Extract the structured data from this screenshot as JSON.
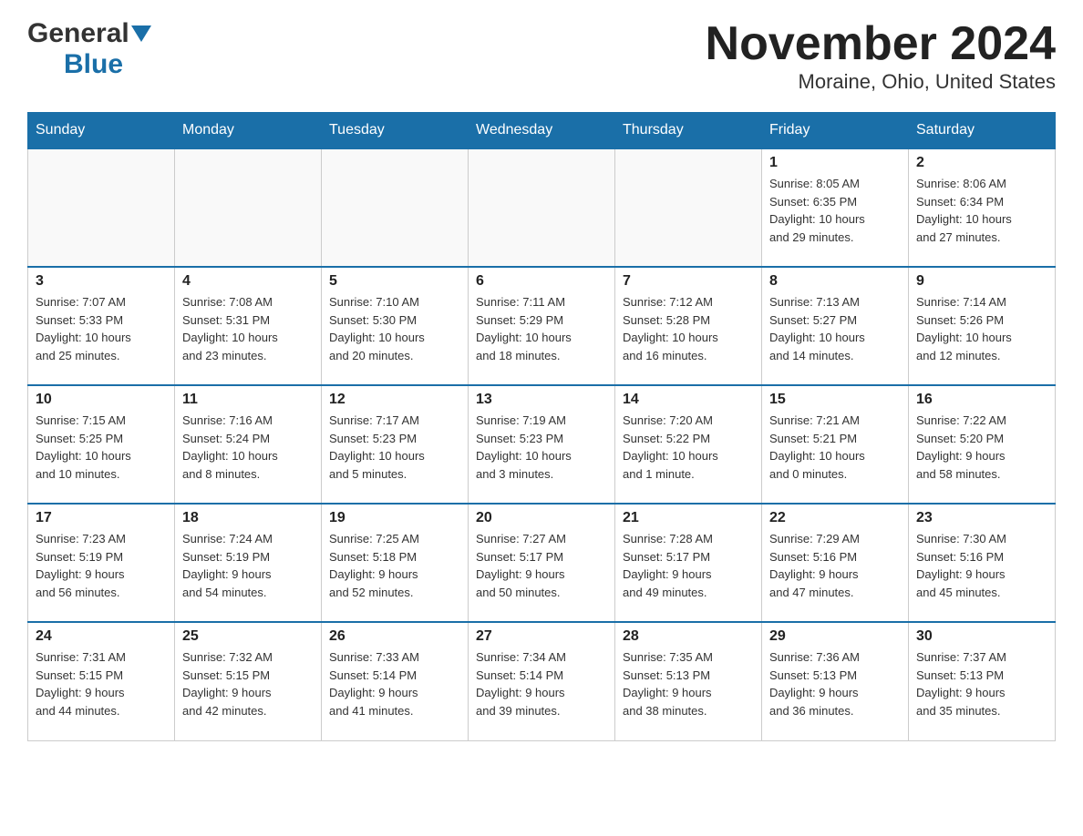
{
  "header": {
    "logo_general": "General",
    "logo_blue": "Blue",
    "month_title": "November 2024",
    "location": "Moraine, Ohio, United States"
  },
  "days_of_week": [
    "Sunday",
    "Monday",
    "Tuesday",
    "Wednesday",
    "Thursday",
    "Friday",
    "Saturday"
  ],
  "weeks": [
    {
      "days": [
        {
          "number": "",
          "info": ""
        },
        {
          "number": "",
          "info": ""
        },
        {
          "number": "",
          "info": ""
        },
        {
          "number": "",
          "info": ""
        },
        {
          "number": "",
          "info": ""
        },
        {
          "number": "1",
          "info": "Sunrise: 8:05 AM\nSunset: 6:35 PM\nDaylight: 10 hours\nand 29 minutes."
        },
        {
          "number": "2",
          "info": "Sunrise: 8:06 AM\nSunset: 6:34 PM\nDaylight: 10 hours\nand 27 minutes."
        }
      ]
    },
    {
      "days": [
        {
          "number": "3",
          "info": "Sunrise: 7:07 AM\nSunset: 5:33 PM\nDaylight: 10 hours\nand 25 minutes."
        },
        {
          "number": "4",
          "info": "Sunrise: 7:08 AM\nSunset: 5:31 PM\nDaylight: 10 hours\nand 23 minutes."
        },
        {
          "number": "5",
          "info": "Sunrise: 7:10 AM\nSunset: 5:30 PM\nDaylight: 10 hours\nand 20 minutes."
        },
        {
          "number": "6",
          "info": "Sunrise: 7:11 AM\nSunset: 5:29 PM\nDaylight: 10 hours\nand 18 minutes."
        },
        {
          "number": "7",
          "info": "Sunrise: 7:12 AM\nSunset: 5:28 PM\nDaylight: 10 hours\nand 16 minutes."
        },
        {
          "number": "8",
          "info": "Sunrise: 7:13 AM\nSunset: 5:27 PM\nDaylight: 10 hours\nand 14 minutes."
        },
        {
          "number": "9",
          "info": "Sunrise: 7:14 AM\nSunset: 5:26 PM\nDaylight: 10 hours\nand 12 minutes."
        }
      ]
    },
    {
      "days": [
        {
          "number": "10",
          "info": "Sunrise: 7:15 AM\nSunset: 5:25 PM\nDaylight: 10 hours\nand 10 minutes."
        },
        {
          "number": "11",
          "info": "Sunrise: 7:16 AM\nSunset: 5:24 PM\nDaylight: 10 hours\nand 8 minutes."
        },
        {
          "number": "12",
          "info": "Sunrise: 7:17 AM\nSunset: 5:23 PM\nDaylight: 10 hours\nand 5 minutes."
        },
        {
          "number": "13",
          "info": "Sunrise: 7:19 AM\nSunset: 5:23 PM\nDaylight: 10 hours\nand 3 minutes."
        },
        {
          "number": "14",
          "info": "Sunrise: 7:20 AM\nSunset: 5:22 PM\nDaylight: 10 hours\nand 1 minute."
        },
        {
          "number": "15",
          "info": "Sunrise: 7:21 AM\nSunset: 5:21 PM\nDaylight: 10 hours\nand 0 minutes."
        },
        {
          "number": "16",
          "info": "Sunrise: 7:22 AM\nSunset: 5:20 PM\nDaylight: 9 hours\nand 58 minutes."
        }
      ]
    },
    {
      "days": [
        {
          "number": "17",
          "info": "Sunrise: 7:23 AM\nSunset: 5:19 PM\nDaylight: 9 hours\nand 56 minutes."
        },
        {
          "number": "18",
          "info": "Sunrise: 7:24 AM\nSunset: 5:19 PM\nDaylight: 9 hours\nand 54 minutes."
        },
        {
          "number": "19",
          "info": "Sunrise: 7:25 AM\nSunset: 5:18 PM\nDaylight: 9 hours\nand 52 minutes."
        },
        {
          "number": "20",
          "info": "Sunrise: 7:27 AM\nSunset: 5:17 PM\nDaylight: 9 hours\nand 50 minutes."
        },
        {
          "number": "21",
          "info": "Sunrise: 7:28 AM\nSunset: 5:17 PM\nDaylight: 9 hours\nand 49 minutes."
        },
        {
          "number": "22",
          "info": "Sunrise: 7:29 AM\nSunset: 5:16 PM\nDaylight: 9 hours\nand 47 minutes."
        },
        {
          "number": "23",
          "info": "Sunrise: 7:30 AM\nSunset: 5:16 PM\nDaylight: 9 hours\nand 45 minutes."
        }
      ]
    },
    {
      "days": [
        {
          "number": "24",
          "info": "Sunrise: 7:31 AM\nSunset: 5:15 PM\nDaylight: 9 hours\nand 44 minutes."
        },
        {
          "number": "25",
          "info": "Sunrise: 7:32 AM\nSunset: 5:15 PM\nDaylight: 9 hours\nand 42 minutes."
        },
        {
          "number": "26",
          "info": "Sunrise: 7:33 AM\nSunset: 5:14 PM\nDaylight: 9 hours\nand 41 minutes."
        },
        {
          "number": "27",
          "info": "Sunrise: 7:34 AM\nSunset: 5:14 PM\nDaylight: 9 hours\nand 39 minutes."
        },
        {
          "number": "28",
          "info": "Sunrise: 7:35 AM\nSunset: 5:13 PM\nDaylight: 9 hours\nand 38 minutes."
        },
        {
          "number": "29",
          "info": "Sunrise: 7:36 AM\nSunset: 5:13 PM\nDaylight: 9 hours\nand 36 minutes."
        },
        {
          "number": "30",
          "info": "Sunrise: 7:37 AM\nSunset: 5:13 PM\nDaylight: 9 hours\nand 35 minutes."
        }
      ]
    }
  ]
}
